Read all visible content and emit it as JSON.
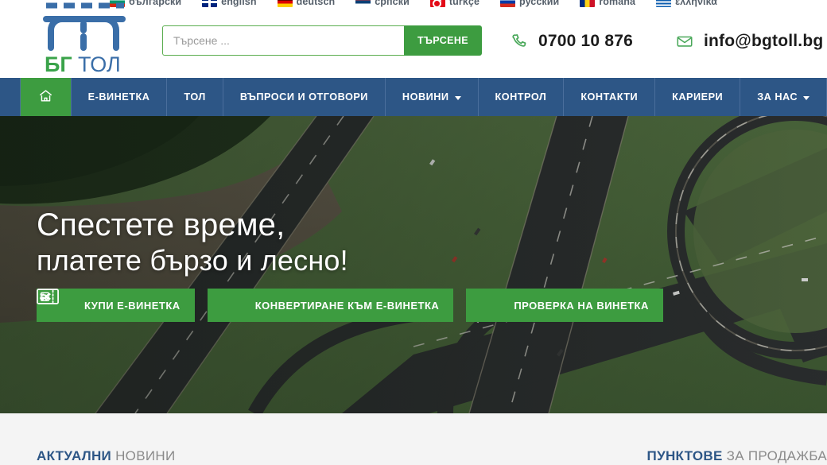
{
  "colors": {
    "brand_blue": "#2d5686",
    "brand_green": "#3d9c40",
    "logo_green": "#3aa34a",
    "text_dark": "#1c1c1c",
    "muted_gray": "#8a8a8a",
    "page_bg": "#f4f4f4"
  },
  "languages": [
    {
      "label": "български",
      "flag": "flag-bulgaria"
    },
    {
      "label": "english",
      "flag": "flag-united-kingdom"
    },
    {
      "label": "deutsch",
      "flag": "flag-germany"
    },
    {
      "label": "српски",
      "flag": "flag-serbia"
    },
    {
      "label": "türkçe",
      "flag": "flag-turkey"
    },
    {
      "label": "русский",
      "flag": "flag-russia"
    },
    {
      "label": "română",
      "flag": "flag-romania"
    },
    {
      "label": "ελληνικά",
      "flag": "flag-greece"
    }
  ],
  "logo": {
    "text_bg": "БГ",
    "text_tol": "ТОЛ",
    "mark": "road-interchange-icon"
  },
  "search": {
    "placeholder": "Търсене ...",
    "value": "",
    "button_label": "ТЪРСЕНЕ"
  },
  "contacts": {
    "phone": "0700 10 876",
    "phone_icon": "phone-icon",
    "email": "info@bgtoll.bg",
    "email_icon": "envelope-icon"
  },
  "nav": {
    "home_icon": "home-icon",
    "items": [
      {
        "label": "Е-ВИНЕТКА",
        "has_caret": false
      },
      {
        "label": "ТОЛ",
        "has_caret": false
      },
      {
        "label": "ВЪПРОСИ И ОТГОВОРИ",
        "has_caret": false
      },
      {
        "label": "НОВИНИ",
        "has_caret": true
      },
      {
        "label": "КОНТРОЛ",
        "has_caret": false
      },
      {
        "label": "КОНТАКТИ",
        "has_caret": false
      },
      {
        "label": "КАРИЕРИ",
        "has_caret": false
      },
      {
        "label": "ЗА НАС",
        "has_caret": true
      }
    ]
  },
  "hero": {
    "headline_line1": "Спестете време,",
    "headline_line2": "платете бързо и лесно!",
    "background": "aerial-highway-interchange-photo",
    "buttons": [
      {
        "label": "КУПИ Е-ВИНЕТКА",
        "icon": "vignette-car-icon"
      },
      {
        "label": "КОНВЕРТИРАНЕ КЪМ Е-ВИНЕТКА",
        "icon": "vignette-exchange-icon"
      },
      {
        "label": "ПРОВЕРКА НА ВИНЕТКА",
        "icon": "vignette-check-icon"
      }
    ]
  },
  "sections": {
    "news": {
      "strong": "АКТУАЛНИ",
      "weak": "НОВИНИ"
    },
    "points": {
      "strong": "ПУНКТОВЕ",
      "weak": "ЗА ПРОДАЖБА"
    }
  }
}
